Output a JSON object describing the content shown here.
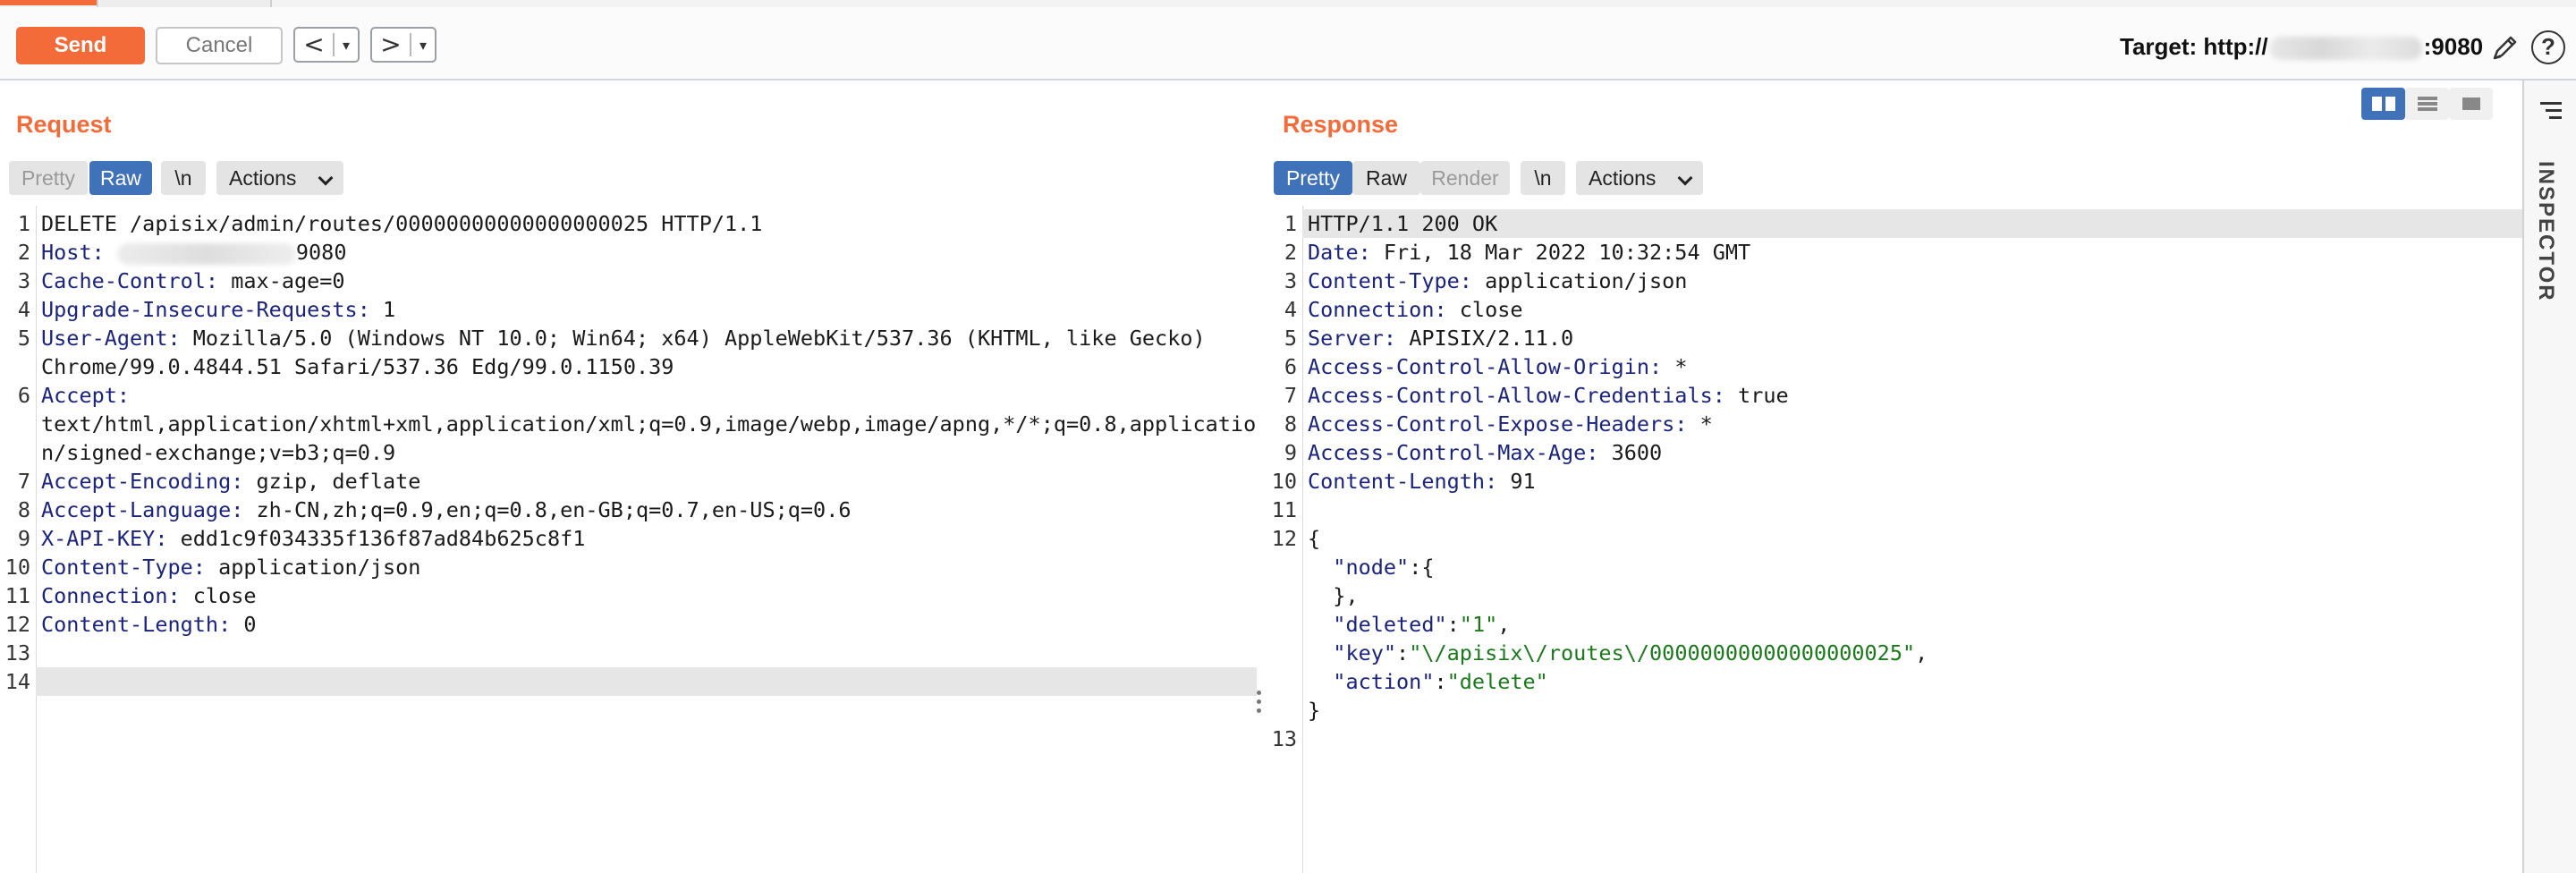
{
  "toolbar": {
    "send_label": "Send",
    "cancel_label": "Cancel",
    "back_arrow": "<",
    "forward_arrow": ">",
    "dropdown_glyph": "▾",
    "target_prefix": "Target: http://",
    "target_suffix": ":9080",
    "help_glyph": "?"
  },
  "request": {
    "title": "Request",
    "buttons": {
      "pretty": "Pretty",
      "raw": "Raw",
      "newline": "\\n",
      "actions": "Actions"
    },
    "line_numbers": [
      "1",
      "2",
      "",
      "3",
      "4",
      "5",
      "",
      "6",
      "",
      "",
      "7",
      "8",
      "9",
      "10",
      "11",
      "12",
      "13",
      "14"
    ],
    "lines": [
      {
        "n": "1",
        "text": "DELETE /apisix/admin/routes/00000000000000000025 HTTP/1.1"
      },
      {
        "n": "2",
        "key": "Host",
        "sep": ": ",
        "blurred": true,
        "val": "9080"
      },
      {
        "n": "3",
        "key": "Cache-Control",
        "sep": ": ",
        "val": "max-age=0"
      },
      {
        "n": "4",
        "key": "Upgrade-Insecure-Requests",
        "sep": ": ",
        "val": "1"
      },
      {
        "n": "5",
        "key": "User-Agent",
        "sep": ": ",
        "val": "Mozilla/5.0 (Windows NT 10.0; Win64; x64) AppleWebKit/537.36 (KHTML, like Gecko)"
      },
      {
        "n": "",
        "text": "Chrome/99.0.4844.51 Safari/537.36 Edg/99.0.1150.39"
      },
      {
        "n": "6",
        "key": "Accept",
        "sep": ":",
        "val": ""
      },
      {
        "n": "",
        "text": "text/html,application/xhtml+xml,application/xml;q=0.9,image/webp,image/apng,*/*;q=0.8,applicatio"
      },
      {
        "n": "",
        "text": "n/signed-exchange;v=b3;q=0.9"
      },
      {
        "n": "7",
        "key": "Accept-Encoding",
        "sep": ": ",
        "val": "gzip, deflate"
      },
      {
        "n": "8",
        "key": "Accept-Language",
        "sep": ": ",
        "val": "zh-CN,zh;q=0.9,en;q=0.8,en-GB;q=0.7,en-US;q=0.6"
      },
      {
        "n": "9",
        "key": "X-API-KEY",
        "sep": ": ",
        "val": "edd1c9f034335f136f87ad84b625c8f1"
      },
      {
        "n": "10",
        "key": "Content-Type",
        "sep": ": ",
        "val": "application/json"
      },
      {
        "n": "11",
        "key": "Connection",
        "sep": ": ",
        "val": "close"
      },
      {
        "n": "12",
        "key": "Content-Length",
        "sep": ": ",
        "val": "0"
      },
      {
        "n": "13",
        "text": ""
      },
      {
        "n": "14",
        "text": ""
      }
    ]
  },
  "response": {
    "title": "Response",
    "buttons": {
      "pretty": "Pretty",
      "raw": "Raw",
      "render": "Render",
      "newline": "\\n",
      "actions": "Actions"
    },
    "lines": [
      {
        "n": "1",
        "text": "HTTP/1.1 200 OK"
      },
      {
        "n": "2",
        "key": "Date",
        "sep": ": ",
        "val": "Fri, 18 Mar 2022 10:32:54 GMT"
      },
      {
        "n": "3",
        "key": "Content-Type",
        "sep": ": ",
        "val": "application/json"
      },
      {
        "n": "4",
        "key": "Connection",
        "sep": ": ",
        "val": "close"
      },
      {
        "n": "5",
        "key": "Server",
        "sep": ": ",
        "val": "APISIX/2.11.0"
      },
      {
        "n": "6",
        "key": "Access-Control-Allow-Origin",
        "sep": ": ",
        "val": "*"
      },
      {
        "n": "7",
        "key": "Access-Control-Allow-Credentials",
        "sep": ": ",
        "val": "true"
      },
      {
        "n": "8",
        "key": "Access-Control-Expose-Headers",
        "sep": ": ",
        "val": "*"
      },
      {
        "n": "9",
        "key": "Access-Control-Max-Age",
        "sep": ": ",
        "val": "3600"
      },
      {
        "n": "10",
        "key": "Content-Length",
        "sep": ": ",
        "val": "91"
      },
      {
        "n": "11",
        "text": ""
      },
      {
        "n": "12",
        "text": "{"
      },
      {
        "n": "",
        "jkey": "\"node\"",
        "jsep": ":",
        "jval": "{"
      },
      {
        "n": "",
        "text": "  },"
      },
      {
        "n": "",
        "jkey": "\"deleted\"",
        "jsep": ":",
        "jstr": "\"1\"",
        "tail": ","
      },
      {
        "n": "",
        "jkey": "\"key\"",
        "jsep": ":",
        "jstr": "\"\\/apisix\\/routes\\/00000000000000000025\"",
        "tail": ","
      },
      {
        "n": "",
        "jkey": "\"action\"",
        "jsep": ":",
        "jstr": "\"delete\"",
        "tail": ""
      },
      {
        "n": "",
        "text": "}"
      },
      {
        "n": "13",
        "text": ""
      }
    ]
  },
  "inspector": {
    "label": "INSPECTOR"
  },
  "colors": {
    "accent": "#f26b38",
    "selected": "#3f72b8"
  }
}
